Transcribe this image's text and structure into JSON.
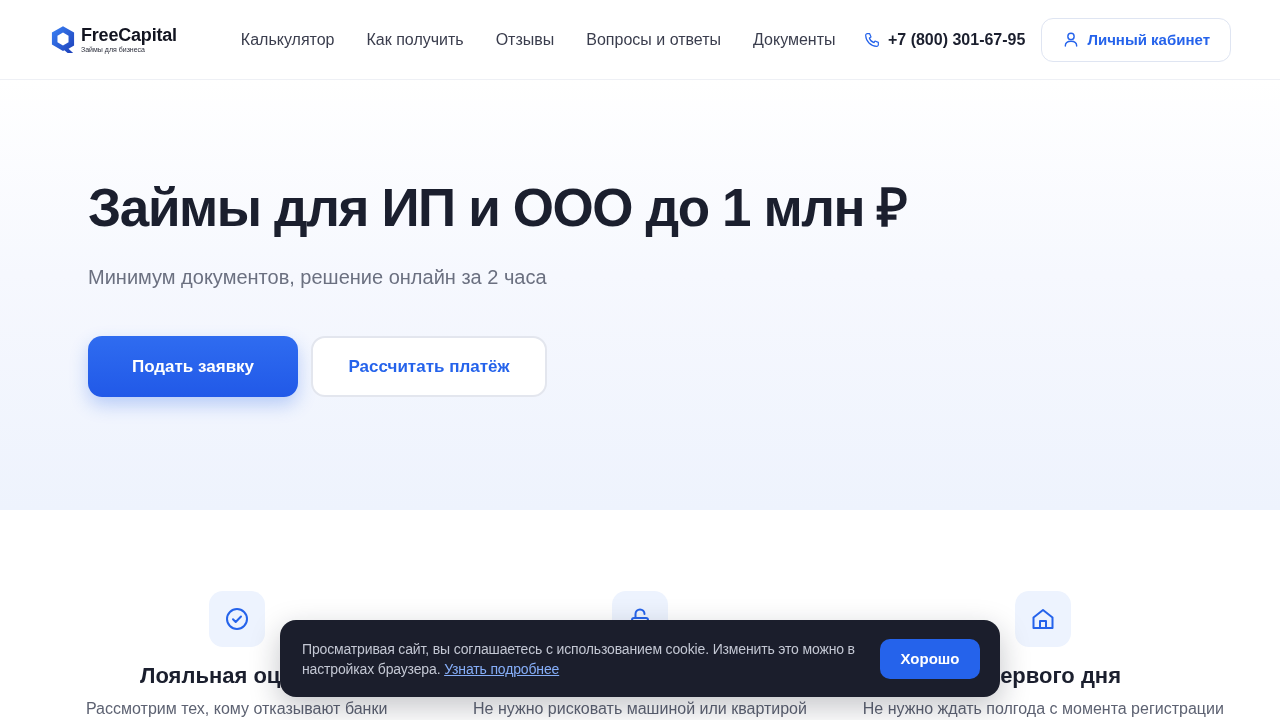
{
  "header": {
    "logo": {
      "name": "FreeCapital",
      "tagline": "Займы для бизнеса"
    },
    "nav": [
      {
        "label": "Калькулятор"
      },
      {
        "label": "Как получить"
      },
      {
        "label": "Отзывы"
      },
      {
        "label": "Вопросы и ответы"
      },
      {
        "label": "Документы"
      }
    ],
    "phone": "+7 (800) 301-67-95",
    "account_button": "Личный кабинет"
  },
  "hero": {
    "title": "Займы для ИП и ООО до 1 млн ₽",
    "subtitle": "Минимум документов, решение онлайн за 2 часа",
    "buttons": [
      {
        "label": "Подать заявку",
        "kind": "primary"
      },
      {
        "label": "Рассчитать платёж",
        "kind": "secondary"
      }
    ]
  },
  "features": [
    {
      "title": "Лояльная оц",
      "description": "Рассмотрим тех, кому отказывают банки"
    },
    {
      "description": "Не нужно рисковать машиной или квартирой"
    },
    {
      "title": "ервого дня",
      "description": "Не нужно ждать полгода с момента регистрации"
    }
  ],
  "cookie_banner": {
    "text": "Просматривая сайт, вы соглашаетесь с использованием cookie. Изменить это можно в настройках браузера.",
    "link": "Узнать подробнее",
    "button": "Хорошо"
  }
}
